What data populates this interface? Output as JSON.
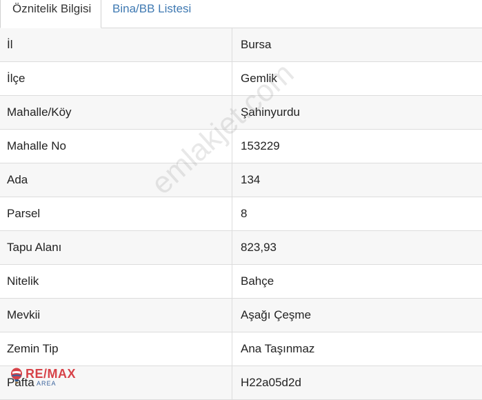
{
  "tabs": [
    {
      "label": "Öznitelik Bilgisi",
      "active": true
    },
    {
      "label": "Bina/BB Listesi",
      "active": false
    }
  ],
  "rows": [
    {
      "label": "İl",
      "value": "Bursa"
    },
    {
      "label": "İlçe",
      "value": "Gemlik"
    },
    {
      "label": "Mahalle/Köy",
      "value": "Şahinyurdu"
    },
    {
      "label": "Mahalle No",
      "value": "153229"
    },
    {
      "label": "Ada",
      "value": "134"
    },
    {
      "label": "Parsel",
      "value": "8"
    },
    {
      "label": "Tapu Alanı",
      "value": "823,93"
    },
    {
      "label": "Nitelik",
      "value": "Bahçe"
    },
    {
      "label": "Mevkii",
      "value": "Aşağı Çeşme"
    },
    {
      "label": "Zemin Tip",
      "value": "Ana Taşınmaz"
    },
    {
      "label": "Pafta",
      "value": "H22a05d2d"
    }
  ],
  "watermark": {
    "text": "emlakjet.com"
  },
  "logo": {
    "brand": "RE/MAX",
    "sub": "AREA"
  },
  "colors": {
    "tab_link": "#3f79b2",
    "row_alt": "#f7f7f7",
    "border": "#dcdcdc",
    "logo_red": "#d2232a",
    "logo_blue": "#1a4a8d"
  }
}
